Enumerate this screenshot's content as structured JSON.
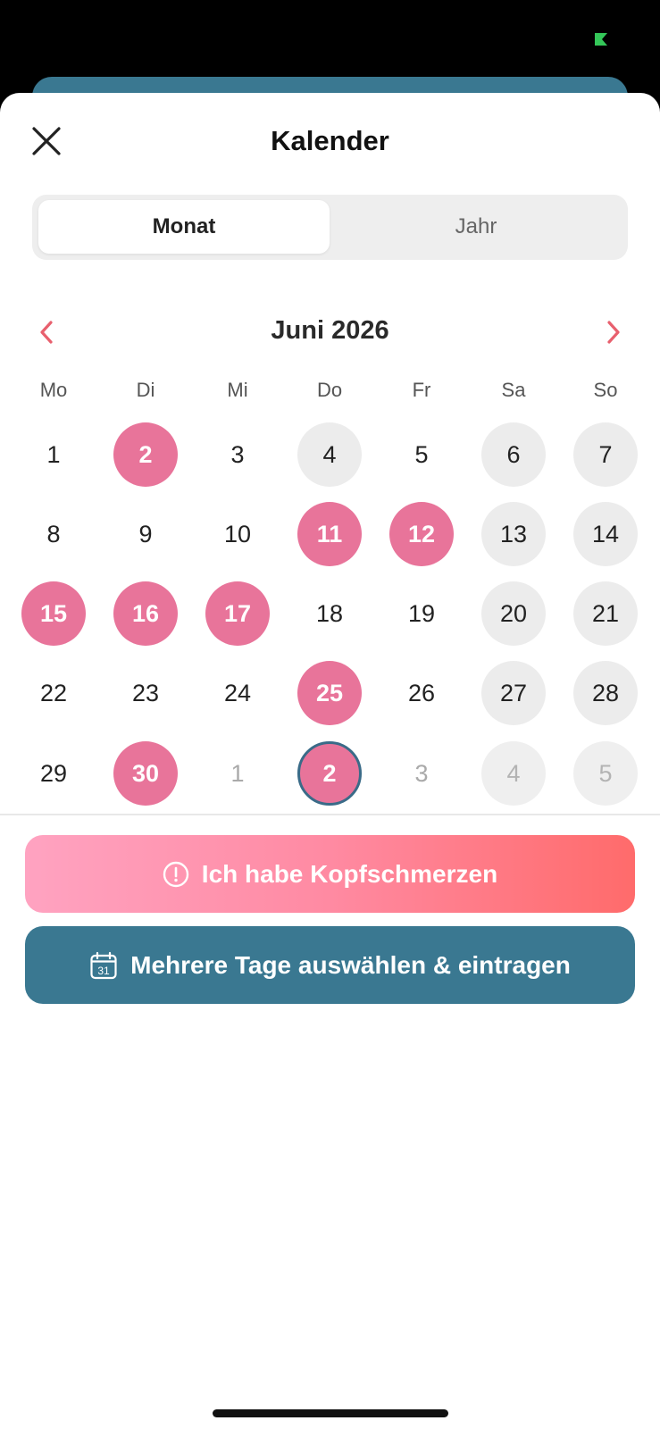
{
  "header": {
    "title": "Kalender",
    "close_icon": "close-icon"
  },
  "view_toggle": {
    "options": [
      "Monat",
      "Jahr"
    ],
    "selected": "Monat"
  },
  "calendar": {
    "month_label": "Juni 2026",
    "weekdays": [
      "Mo",
      "Di",
      "Mi",
      "Do",
      "Fr",
      "Sa",
      "So"
    ],
    "weeks": [
      [
        "1",
        "2",
        "3",
        "4",
        "5",
        "6",
        "7"
      ],
      [
        "8",
        "9",
        "10",
        "11",
        "12",
        "13",
        "14"
      ],
      [
        "15",
        "16",
        "17",
        "18",
        "19",
        "20",
        "21"
      ],
      [
        "22",
        "23",
        "24",
        "25",
        "26",
        "27",
        "28"
      ],
      [
        "29",
        "30",
        "1",
        "2",
        "3",
        "4",
        "5"
      ]
    ],
    "marked_days": [
      "2",
      "11",
      "12",
      "15",
      "16",
      "17",
      "25",
      "30",
      "2 (next month)"
    ],
    "today": "2 (next month)"
  },
  "actions": {
    "headache_label": "Ich habe Kopfschmerzen",
    "multi_select_label": "Mehrere Tage auswählen & eintragen"
  },
  "colors": {
    "marked_day": "#e8749a",
    "weekend_bg": "#ececec",
    "teal_button": "#3a7891",
    "nav_arrow": "#e8606e",
    "status_green": "#34c759"
  }
}
